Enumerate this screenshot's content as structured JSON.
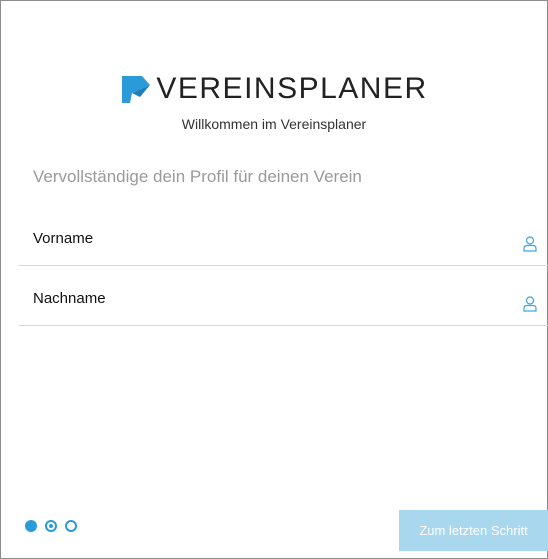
{
  "brand": {
    "name": "VEREINSPLANER",
    "welcome": "Willkommen im Vereinsplaner",
    "logo_icon": "vereinsplaner-logo-icon",
    "accent_color": "#2a9ad9"
  },
  "form": {
    "heading": "Vervollständige dein Profil für deinen Verein",
    "fields": [
      {
        "label": "Vorname",
        "icon": "user-icon"
      },
      {
        "label": "Nachname",
        "icon": "user-icon"
      }
    ]
  },
  "wizard": {
    "steps_total": 3,
    "current_step": 2,
    "next_button_label": "Zum letzten Schritt",
    "next_button_color": "#a9d7ee"
  }
}
